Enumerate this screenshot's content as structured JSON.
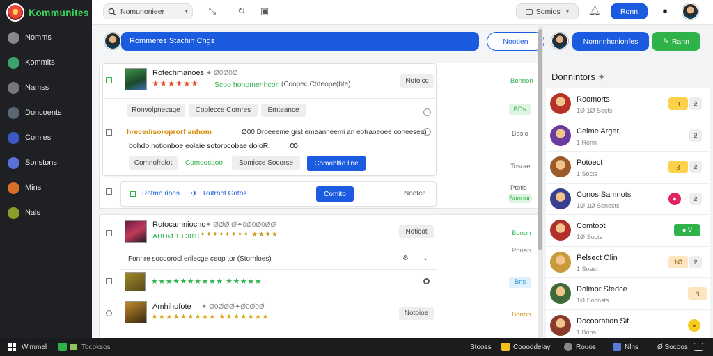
{
  "app": {
    "name": "Kommunites",
    "accent": "#1a5be0",
    "green": "#2fb24a"
  },
  "sidebar": {
    "items": [
      {
        "label": "Nomms",
        "icon": "home-icon",
        "color": "#888888"
      },
      {
        "label": "Kommits",
        "icon": "globe-icon",
        "color": "#3aa36b"
      },
      {
        "label": "Namss",
        "icon": "trending-icon",
        "color": "#777777"
      },
      {
        "label": "Doncoents",
        "icon": "shield-icon",
        "color": "#5a6672"
      },
      {
        "label": "Comies",
        "icon": "grid-icon",
        "color": "#3b59c4"
      },
      {
        "label": "Sonstons",
        "icon": "planet-icon",
        "color": "#5b6fd8"
      },
      {
        "label": "Mins",
        "icon": "game-icon",
        "color": "#d8702a"
      },
      {
        "label": "Nals",
        "icon": "puzzle-icon",
        "color": "#8a9d2a"
      }
    ]
  },
  "topbar": {
    "search_text": "Nomunonieer",
    "filter_label": "Somios",
    "primary_button": "Ronn"
  },
  "composer": {
    "input_text": "Rommeres Stachin Chgs",
    "button_label": "Nootien"
  },
  "posts": [
    {
      "title": "Rotechmanoes",
      "meta": "✦ Ø0Ø0Ø",
      "stars": "★★★★★★",
      "subtitle": "Scoo honomenhcon",
      "subtitle_meta": "(Coopec Ctrteope(bte)",
      "tag": "Notoicc",
      "status": "Bonnon",
      "chips": [
        "Ronvolpnecage",
        "Coplecce Comres",
        "Emteance"
      ],
      "highlight": "hrecedisoroprorf anhom",
      "highlight_rest": "Ø00 Droeeeme grst emeanneemi an eotraoeoee ooneesea)",
      "body": "bohdo notionboe eolaie sotorpcobae doloR.",
      "actions": [
        "Comnofrolot",
        "Comoocdoo",
        "Somicce Socorse"
      ],
      "action_primary": "Comobltio line",
      "status2": "BDs",
      "status3": "Bosio"
    },
    {
      "link1": "Rotmo rioes",
      "link2": "Rutrnot Gotos",
      "button": "Comito",
      "tag": "Nootce",
      "status": "Tosrae",
      "status2": "Ptotis"
    },
    {
      "title": "Rotocamniochc",
      "meta": "✦ ØØØ Ø✦0Ø0Ø0ØØ",
      "rating": "ABDØ 13 3810",
      "stars": "✦✦✦✦✦✦✦✦ ★★★★",
      "tag": "Noticot",
      "status": "Bonon",
      "status2": "Ponan"
    },
    {
      "body": "Fonnre socoorocl erilecge ceop tor (Stornloes)",
      "stars": "★★★★★★★★★★ ★★★★★",
      "status": "Bns"
    },
    {
      "title": "Amhihofote",
      "meta": "✦ Ø0ØØØ✦Ø0Ø0Ø",
      "stars": "★★★★★★★★★ ★★★★★★★",
      "tag": "Notoioe",
      "status": "Bonon"
    }
  ],
  "rightpanel": {
    "user_button": "Nomnnhcnionfes",
    "action_button": "Rann",
    "title": "Donnintors",
    "items": [
      {
        "name": "Roomorts",
        "sub": "1Ø 1Ø Socts",
        "badge": "Ɜ",
        "badge_color": "#fbd24a",
        "badge2": "ƻ",
        "avatar_color": "#b8322a"
      },
      {
        "name": "Celme Arger",
        "sub": "1 Ronn",
        "badge": "",
        "badge_color": "",
        "badge2": "ƻ",
        "avatar_color": "#6a3ca0"
      },
      {
        "name": "Potoect",
        "sub": "1 Socts",
        "badge": "Ɜ",
        "badge_color": "#fbd24a",
        "badge2": "ƻ",
        "avatar_color": "#9a5a2a"
      },
      {
        "name": "Conos Samnots",
        "sub": "1Ø 1Ø Sonosts",
        "badge": "●",
        "badge_color": "#e0245e",
        "badge2": "ƻ",
        "avatar_color": "#3a3e8e"
      },
      {
        "name": "Comtoot",
        "sub": "1Ø Socts",
        "badge": "● Ɐ",
        "badge_color": "#2fb24a",
        "badge2": "",
        "avatar_color": "#b0302a"
      },
      {
        "name": "Pelsect Olin",
        "sub": "1 Soast",
        "badge": "1Ø",
        "badge_color": "#fde5c2",
        "badge2": "ƻ",
        "avatar_color": "#c79a3a"
      },
      {
        "name": "Dolmor Stedce",
        "sub": "1Ø Socosts",
        "badge": "Ɜ",
        "badge_color": "#fde5c2",
        "badge2": "",
        "avatar_color": "#3e6a3a"
      },
      {
        "name": "Docooration Sit",
        "sub": "1 Bons",
        "badge": "●",
        "badge_color": "#f6cd1d",
        "badge2": "",
        "avatar_color": "#8a3a2a"
      }
    ]
  },
  "taskbar": {
    "start_label": "Wimmel",
    "item1": "Tocoksos",
    "right": [
      "Stooss",
      "Coooddelay",
      "Rouos",
      "Nlns",
      "Ø Socoos"
    ]
  }
}
